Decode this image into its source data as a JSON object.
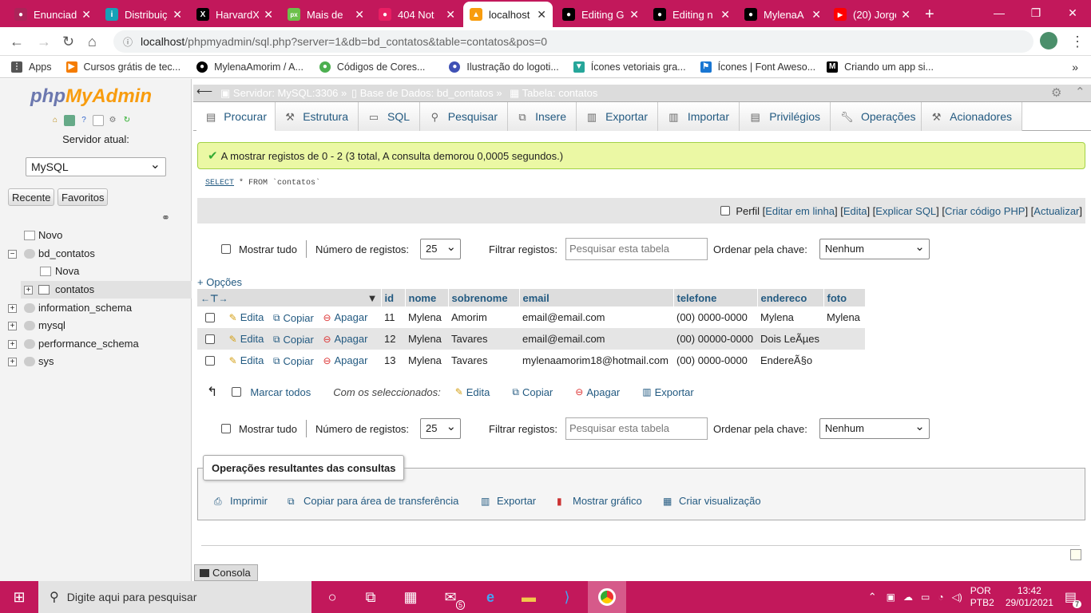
{
  "browser": {
    "tabs": [
      {
        "title": "Enunciad",
        "color": "#ab2459",
        "glyph": "●"
      },
      {
        "title": "Distribuiç",
        "color": "#16a2b8",
        "glyph": "i"
      },
      {
        "title": "HarvardX",
        "color": "#000000",
        "glyph": "X"
      },
      {
        "title": "Mais de",
        "color": "#6cc04a",
        "glyph": "px"
      },
      {
        "title": "404 Not",
        "color": "#e91e63",
        "glyph": "●"
      },
      {
        "title": "localhost",
        "color": "#f89c0e",
        "glyph": "▲"
      },
      {
        "title": "Editing G",
        "color": "#000000",
        "glyph": "●"
      },
      {
        "title": "Editing n",
        "color": "#000000",
        "glyph": "●"
      },
      {
        "title": "MylenaA",
        "color": "#000000",
        "glyph": "●"
      },
      {
        "title": "(20) Jorge",
        "color": "#ff0000",
        "glyph": "▶"
      }
    ],
    "url_host": "localhost",
    "url_path": "/phpmyadmin/sql.php?server=1&db=bd_contatos&table=contatos&pos=0",
    "bookmarks": [
      {
        "label": "Apps",
        "color": "#555555"
      },
      {
        "label": "Cursos grátis de tec...",
        "color": "#f57c00"
      },
      {
        "label": "MylenaAmorim / A...",
        "color": "#000000"
      },
      {
        "label": "Códigos de Cores...",
        "color": "#4caf50"
      },
      {
        "label": "Ilustração do logoti...",
        "color": "#3f51b5"
      },
      {
        "label": "Ícones vetoriais gra...",
        "color": "#26a69a"
      },
      {
        "label": "Ícones | Font Aweso...",
        "color": "#1976d2"
      },
      {
        "label": "Criando um app si...",
        "color": "#000000"
      }
    ]
  },
  "left": {
    "logo_php": "php",
    "logo_admin": "MyAdmin",
    "server_label": "Servidor atual:",
    "server_value": "MySQL",
    "btn_recent": "Recente",
    "btn_fav": "Favoritos",
    "tree": [
      {
        "label": "Novo"
      },
      {
        "label": "bd_contatos"
      },
      {
        "label": "Nova"
      },
      {
        "label": "contatos"
      },
      {
        "label": "information_schema"
      },
      {
        "label": "mysql"
      },
      {
        "label": "performance_schema"
      },
      {
        "label": "sys"
      }
    ]
  },
  "main": {
    "breadcrumb": {
      "server": "Servidor: MySQL:3306",
      "db": "Base de Dados: bd_contatos",
      "table": "Tabela: contatos"
    },
    "tabs": [
      "Procurar",
      "Estrutura",
      "SQL",
      "Pesquisar",
      "Insere",
      "Exportar",
      "Importar",
      "Privilégios",
      "Operações",
      "Acionadores"
    ],
    "success": "A mostrar registos de 0 - 2 (3 total, A consulta demorou 0,0005 segundos.)",
    "sql_select": "SELECT",
    "sql_rest": " * FROM `contatos`",
    "sql_links": {
      "perfil": "Perfil",
      "inline": "Editar em linha",
      "edita": "Edita",
      "explicar": "Explicar SQL",
      "php": "Criar código PHP",
      "actualizar": "Actualizar"
    },
    "nav": {
      "show_all": "Mostrar tudo",
      "num_label": "Número de registos:",
      "num_value": "25",
      "filter_label": "Filtrar registos:",
      "filter_placeholder": "Pesquisar esta tabela",
      "order_label": "Ordenar pela chave:",
      "order_value": "Nenhum"
    },
    "options": "+ Opções",
    "columns": [
      "id",
      "nome",
      "sobrenome",
      "email",
      "telefone",
      "endereco",
      "foto"
    ],
    "actions": {
      "edit": "Edita",
      "copy": "Copiar",
      "delete": "Apagar"
    },
    "rows": [
      {
        "id": "11",
        "nome": "Mylena",
        "sobrenome": "Amorim",
        "email": "email@email.com",
        "telefone": "(00) 0000-0000",
        "endereco": "Mylena",
        "foto": "Mylena"
      },
      {
        "id": "12",
        "nome": "Mylena",
        "sobrenome": "Tavares",
        "email": "email@email.com",
        "telefone": "(00) 00000-0000",
        "endereco": "Dois LeÃµes",
        "foto": ""
      },
      {
        "id": "13",
        "nome": "Mylena",
        "sobrenome": "Tavares",
        "email": "mylenaamorim18@hotmail.com",
        "telefone": "(00) 0000-0000",
        "endereco": "EndereÃ§o",
        "foto": ""
      }
    ],
    "bulk": {
      "mark_all": "Marcar todos",
      "with_selected": "Com os seleccionados:",
      "edit": "Edita",
      "copy": "Copiar",
      "delete": "Apagar",
      "export": "Exportar"
    },
    "ops": {
      "legend": "Operações resultantes das consultas",
      "print": "Imprimir",
      "clipboard": "Copiar para área de transferência",
      "export": "Exportar",
      "chart": "Mostrar gráfico",
      "view": "Criar visualização"
    },
    "console": "Consola"
  },
  "taskbar": {
    "search_placeholder": "Digite aqui para pesquisar",
    "lang1": "POR",
    "lang2": "PTB2",
    "time": "13:42",
    "date": "29/01/2021",
    "mail_badge": "5",
    "notif_badge": "7"
  }
}
